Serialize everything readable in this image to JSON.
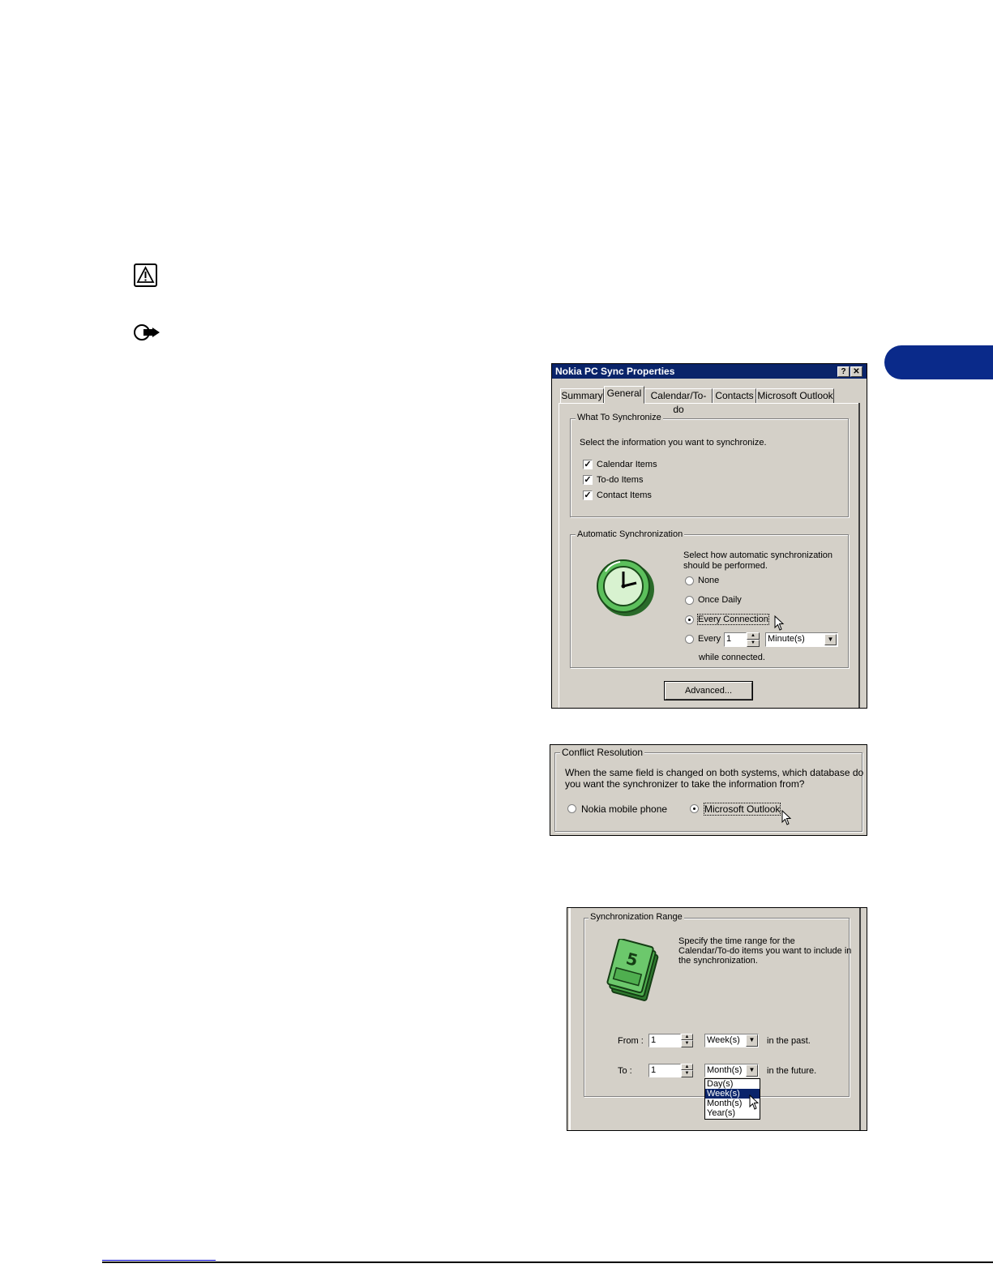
{
  "notices": {
    "warning_icon": "warning-triangle-icon",
    "note_icon": "pointing-hand-icon"
  },
  "dialog1": {
    "title": "Nokia PC Sync Properties",
    "help_glyph": "?",
    "close_glyph": "✕",
    "tabs": [
      "Summary",
      "General",
      "Calendar/To-do",
      "Contacts",
      "Microsoft Outlook"
    ],
    "selected_tab": "General",
    "what_group": {
      "label": "What To Synchronize",
      "instruction": "Select the information you want to synchronize.",
      "items": [
        "Calendar Items",
        "To-do Items",
        "Contact Items"
      ],
      "checked": [
        true,
        true,
        true
      ]
    },
    "auto_group": {
      "label": "Automatic Synchronization",
      "instruction_line1": "Select how automatic synchronization",
      "instruction_line2": "should be performed.",
      "options": [
        "None",
        "Once Daily",
        "Every Connection",
        "Every"
      ],
      "selected": "Every Connection",
      "every_value": "1",
      "every_unit": "Minute(s)",
      "while_connected": "while connected."
    },
    "advanced_button": "Advanced..."
  },
  "dialog2": {
    "label": "Conflict Resolution",
    "question_line1": "When the same field is changed on both systems, which database do",
    "question_line2": "you want the synchronizer to take the information from?",
    "options": [
      "Nokia mobile phone",
      "Microsoft Outlook"
    ],
    "selected": "Microsoft Outlook"
  },
  "dialog3": {
    "label": "Synchronization Range",
    "instruction_line1": "Specify the time range for the",
    "instruction_line2": "Calendar/To-do items you want to include in",
    "instruction_line3": "the synchronization.",
    "from_label": "From :",
    "from_value": "1",
    "from_unit": "Week(s)",
    "from_suffix": "in the past.",
    "to_label": "To :",
    "to_value": "1",
    "to_unit": "Month(s)",
    "to_suffix": "in the future.",
    "dropdown_options": [
      "Day(s)",
      "Week(s)",
      "Month(s)",
      "Year(s)"
    ],
    "dropdown_highlighted": "Week(s)"
  },
  "colors": {
    "titlebar": "#0a246a",
    "dialog_face": "#d4d0c8",
    "chapter_tab": "#0a2a8a",
    "clock_green": "#5cc05c",
    "money_green": "#4fae4f"
  }
}
